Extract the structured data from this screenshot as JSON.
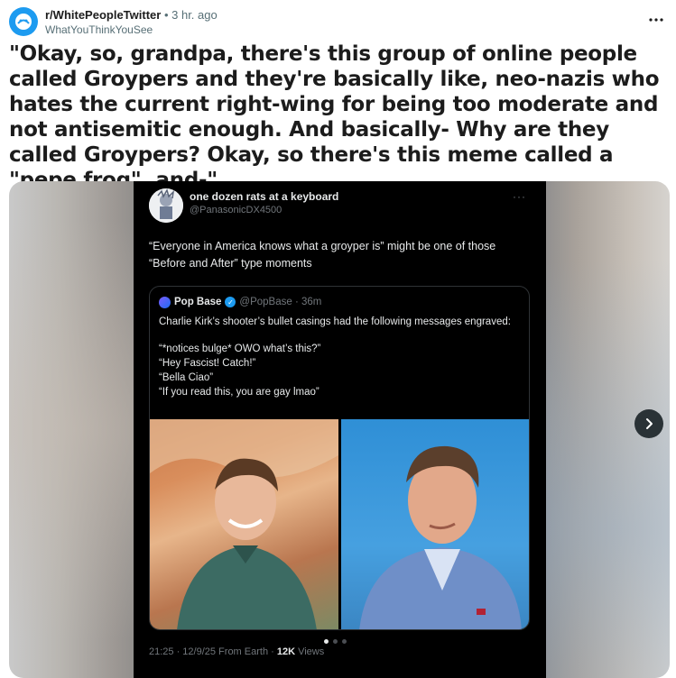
{
  "post": {
    "subreddit": "r/WhitePeopleTwitter",
    "time_ago": "• 3 hr. ago",
    "author": "WhatYouThinkYouSee",
    "title": "\"Okay, so, grandpa, there's this group of online people called Groypers and they're basically like, neo-nazis who hates the current right-wing for being too moderate and not antisemitic enough. And basically- Why are they called Groypers? Okay, so there's this meme called a \"pepe frog\", and-\"",
    "more_icon": "more-horizontal-icon"
  },
  "tweet": {
    "name": "one dozen rats at a keyboard",
    "handle": "@PanasonicDX4500",
    "more": "···",
    "text": "“Everyone in America knows what a groyper is” might be one of those “Before and After” type moments",
    "quote": {
      "name": "Pop Base",
      "handle_time": "@PopBase · 36m",
      "lines": [
        "Charlie Kirk’s shooter’s bullet casings had the following messages engraved:",
        "",
        "“*notices bulge* OWO what’s this?”",
        "“Hey Fascist! Catch!”",
        "“Bella Ciao”",
        "“If you read this, you are gay lmao”"
      ]
    },
    "footer_time": "21:25 · 12/9/25 From Earth · ",
    "footer_views_count": "12K",
    "footer_views_label": " Views"
  },
  "carousel": {
    "total_dots": 3,
    "active_index": 0,
    "next_icon": "chevron-right-icon"
  },
  "colors": {
    "tweet_bg": "#000000",
    "verified": "#1d9bf0",
    "next_button": "#2a3236"
  }
}
